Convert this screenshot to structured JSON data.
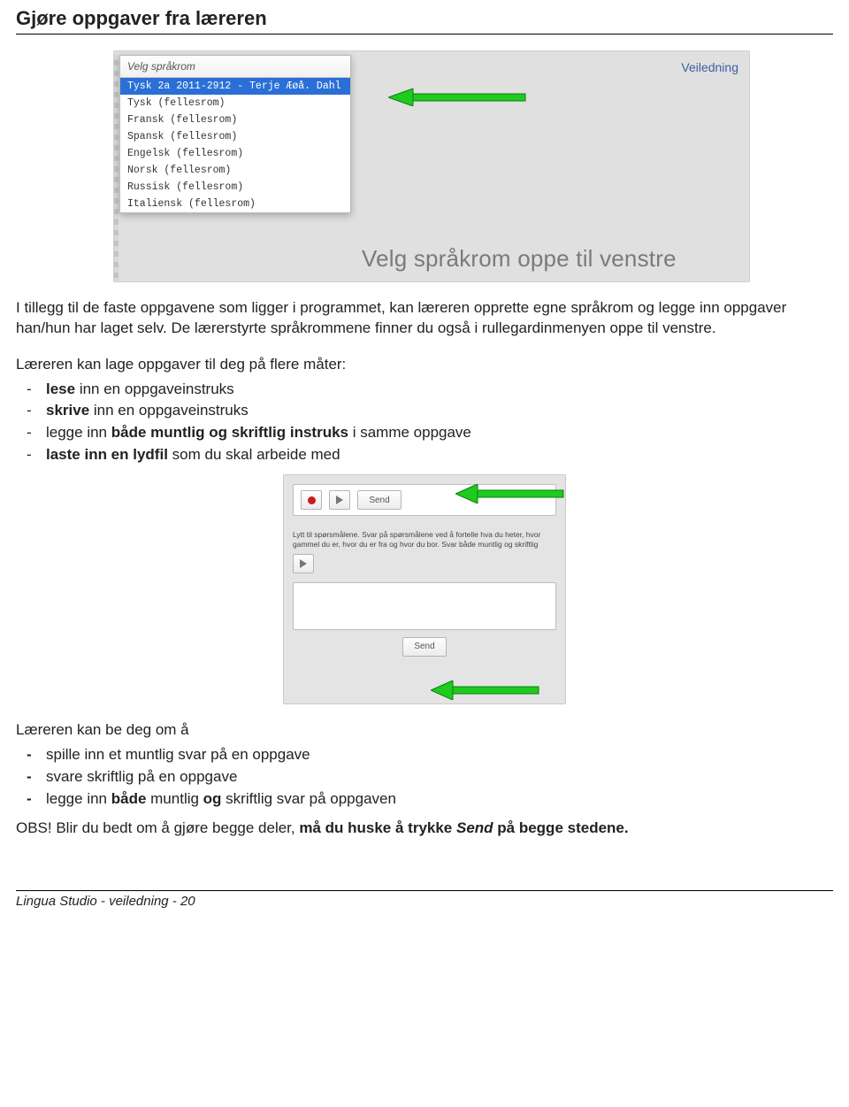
{
  "page_title": "Gjøre oppgaver fra læreren",
  "shot1": {
    "dropdown_header": "Velg språkrom",
    "dropdown_selected": "Tysk 2a  2011-2912   - Terje Æøå. Dahl",
    "dropdown_items": [
      "Tysk  (fellesrom)",
      "Fransk  (fellesrom)",
      "Spansk  (fellesrom)",
      "Engelsk  (fellesrom)",
      "Norsk  (fellesrom)",
      "Russisk  (fellesrom)",
      "Italiensk  (fellesrom)"
    ],
    "right_link": "Veiledning",
    "caption": "Velg språkrom oppe til venstre"
  },
  "para1": "I tillegg til de faste oppgavene som ligger i programmet, kan læreren opprette egne språkrom og legge inn oppgaver han/hun har laget selv. De lærerstyrte språkrommene finner du også i rullegardinmenyen oppe til venstre.",
  "list1_intro": "Læreren kan lage oppgaver til deg på flere måter:",
  "list1": {
    "i0_a_bold": "lese",
    "i0_b": " inn en oppgaveinstruks",
    "i1_a_bold": "skrive",
    "i1_b": " inn en oppgaveinstruks",
    "i2_a": "legge inn ",
    "i2_b_bold": "både muntlig og skriftlig instruks",
    "i2_c": " i samme oppgave",
    "i3_a_bold": "laste inn en lydfil",
    "i3_b": " som du skal arbeide med"
  },
  "shot2": {
    "send_label": "Send",
    "instruction_text": "Lytt til spørsmålene. Svar på spørsmålene ved å fortelle hva du heter, hvor gammel du er, hvor du er fra og hvor du bor. Svar både muntlig og skriftlig"
  },
  "list2_intro": "Læreren kan be deg om å",
  "list2": {
    "i0": "spille inn et muntlig svar på en oppgave",
    "i1": "svare skriftlig på en oppgave",
    "i2_a": "legge inn ",
    "i2_b_bold": "både",
    "i2_c": " muntlig ",
    "i2_d_bold": "og",
    "i2_e": " skriftlig svar på oppgaven"
  },
  "obs_a": "OBS! Blir du bedt om å gjøre begge deler, ",
  "obs_b_bold": "må du huske å trykke ",
  "obs_c_bolditalic": "Send",
  "obs_d_bold": " på begge stedene.",
  "footer": "Lingua Studio - veiledning - 20"
}
